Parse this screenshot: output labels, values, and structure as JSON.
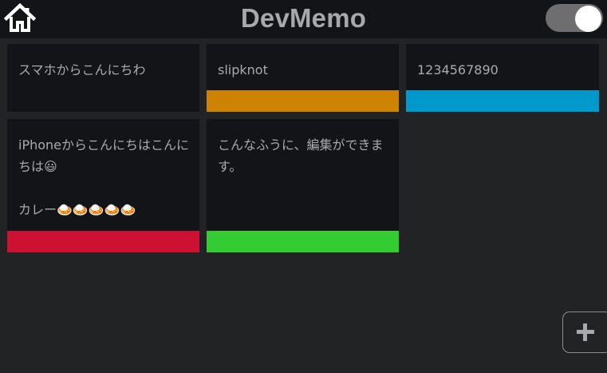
{
  "header": {
    "title": "DevMemo",
    "home_icon": "home-icon",
    "theme_toggle": {
      "on": true,
      "icon": "toggle-switch"
    }
  },
  "colors": {
    "background": "#222325",
    "header": "#131417",
    "card": "#131417",
    "text": "#a9a9ae"
  },
  "memos": [
    {
      "text": "スマホからこんにちわ",
      "color": ""
    },
    {
      "text": "slipknot",
      "color": "#cc8400"
    },
    {
      "text": "1234567890",
      "color": "#0099cc"
    },
    {
      "text": "iPhoneからこんにちはこんにちは😃\n\nカレー🍛🍛🍛🍛🍛",
      "color": "#cc1133"
    },
    {
      "text": "こんなふうに、編集ができます。",
      "color": "#33cc33"
    }
  ],
  "fab": {
    "icon": "plus-icon"
  }
}
